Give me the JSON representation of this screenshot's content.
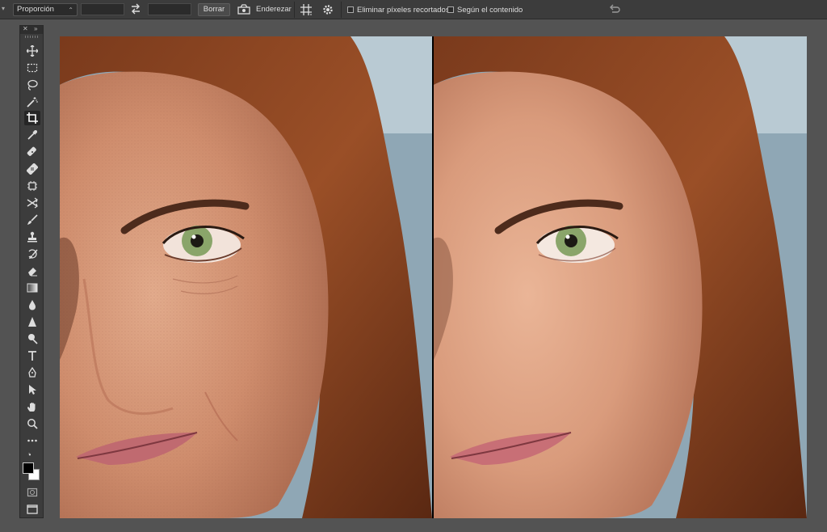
{
  "options_bar": {
    "ratio_select": "Proporción",
    "clear_button": "Borrar",
    "straighten_label": "Enderezar",
    "delete_cropped_label": "Eliminar píxeles recortados",
    "content_aware_label": "Según el contenido"
  },
  "tools": [
    "move-tool",
    "marquee-tool",
    "lasso-tool",
    "magic-wand-tool",
    "crop-tool",
    "eyedropper-tool",
    "spot-healing-tool",
    "healing-tool",
    "patch-tool",
    "content-move-tool",
    "brush-tool",
    "clone-stamp-tool",
    "history-brush-tool",
    "eraser-tool",
    "gradient-tool",
    "blur-tool",
    "sharpen-tool",
    "dodge-tool",
    "type-tool",
    "pen-tool",
    "path-selection-tool",
    "hand-tool",
    "zoom-tool",
    "more-tools"
  ],
  "colors": {
    "foreground": "#000000",
    "background": "#ffffff"
  },
  "canvas": {
    "left_image": "portrait-before-retouch",
    "right_image": "portrait-after-retouch"
  }
}
